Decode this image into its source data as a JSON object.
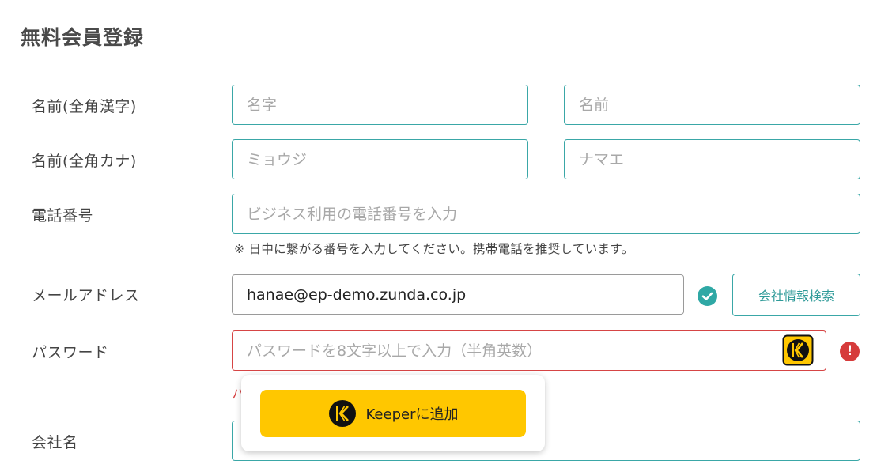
{
  "form": {
    "title": "無料会員登録",
    "name_kanji": {
      "label": "名前(全角漢字)",
      "last_placeholder": "名字",
      "first_placeholder": "名前"
    },
    "name_kana": {
      "label": "名前(全角カナ)",
      "last_placeholder": "ミョウジ",
      "first_placeholder": "ナマエ"
    },
    "phone": {
      "label": "電話番号",
      "placeholder": "ビジネス利用の電話番号を入力",
      "hint": "※ 日中に繋がる番号を入力してください。携帯電話を推奨しています。"
    },
    "email": {
      "label": "メールアドレス",
      "value": "hanae@ep-demo.zunda.co.jp",
      "search_button": "会社情報検索",
      "status_icon": "check-circle-icon"
    },
    "password": {
      "label": "パスワード",
      "placeholder": "パスワードを8文字以上で入力（半角英数）",
      "error_icon": "!",
      "error_text_peek": "パ"
    },
    "company": {
      "label": "会社名",
      "value": ""
    }
  },
  "keeper": {
    "add_button": "Keeperに追加",
    "brand_color": "#ffc700"
  },
  "colors": {
    "accent": "#3aa7a7",
    "error": "#d64545"
  }
}
